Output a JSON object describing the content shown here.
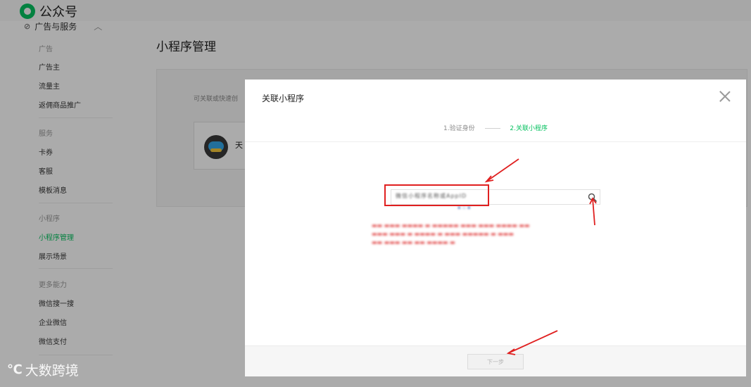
{
  "app": {
    "name": "公众号",
    "brand_color": "#07c160",
    "logo_icon": "wechat-official-account-logo"
  },
  "sidebar": {
    "group_head": "广告与服务",
    "sections": [
      {
        "category": "广告",
        "items": [
          "广告主",
          "流量主",
          "返佣商品推广"
        ]
      },
      {
        "category": "服务",
        "items": [
          "卡券",
          "客服",
          "模板消息"
        ]
      },
      {
        "category": "小程序",
        "items": [
          "小程序管理",
          "展示场景"
        ]
      },
      {
        "category": "更多能力",
        "items": [
          "微信搜一搜",
          "企业微信",
          "微信支付"
        ]
      }
    ],
    "active_item": "小程序管理"
  },
  "main": {
    "title": "小程序管理",
    "hint": "可关联或快速创",
    "mini_program_name": "天"
  },
  "dialog": {
    "title": "关联小程序",
    "steps": [
      {
        "label": "1.验证身份",
        "state": "done"
      },
      {
        "label": "2.关联小程序",
        "state": "active"
      }
    ],
    "search": {
      "value": "微信小程序名称或AppID"
    },
    "next_label": "下一步",
    "accent_color": "#07c160",
    "warning_color": "#e24a4a"
  },
  "annotations": {
    "arrow_color": "#e02020"
  },
  "watermark": {
    "mark": "℃",
    "text": "大数跨境"
  }
}
